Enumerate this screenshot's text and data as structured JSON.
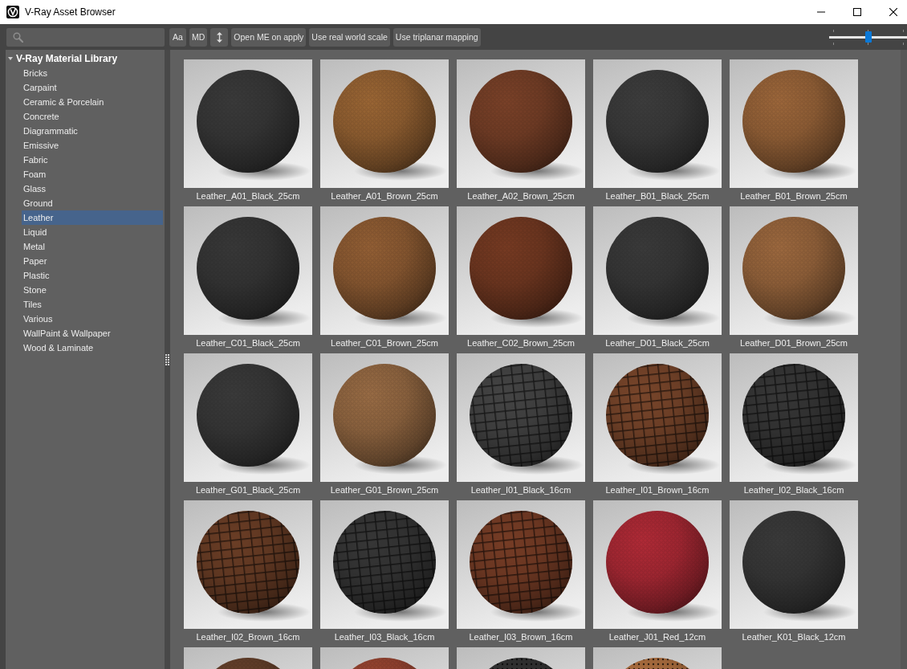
{
  "window": {
    "title": "V-Ray Asset Browser"
  },
  "toolbar": {
    "buttons": [
      {
        "kind": "text",
        "label": "Aa"
      },
      {
        "kind": "text",
        "label": "MD"
      },
      {
        "kind": "arrows"
      },
      {
        "kind": "text",
        "label": "Open ME on apply"
      },
      {
        "kind": "text",
        "label": "Use real world scale"
      },
      {
        "kind": "text",
        "label": "Use triplanar mapping"
      }
    ],
    "slider": {
      "level": 0.5
    }
  },
  "library": {
    "title": "V-Ray Material Library",
    "expanded": true,
    "children": [
      {
        "label": "Bricks",
        "selected": false
      },
      {
        "label": "Carpaint",
        "selected": false
      },
      {
        "label": "Ceramic & Porcelain",
        "selected": false
      },
      {
        "label": "Concrete",
        "selected": false
      },
      {
        "label": "Diagrammatic",
        "selected": false
      },
      {
        "label": "Emissive",
        "selected": false
      },
      {
        "label": "Fabric",
        "selected": false
      },
      {
        "label": "Foam",
        "selected": false
      },
      {
        "label": "Glass",
        "selected": false
      },
      {
        "label": "Ground",
        "selected": false
      },
      {
        "label": "Leather",
        "selected": true
      },
      {
        "label": "Liquid",
        "selected": false
      },
      {
        "label": "Metal",
        "selected": false
      },
      {
        "label": "Paper",
        "selected": false
      },
      {
        "label": "Plastic",
        "selected": false
      },
      {
        "label": "Stone",
        "selected": false
      },
      {
        "label": "Tiles",
        "selected": false
      },
      {
        "label": "Various",
        "selected": false
      },
      {
        "label": "WallPaint & Wallpaper",
        "selected": false
      },
      {
        "label": "Wood & Laminate",
        "selected": false
      }
    ]
  },
  "materials": [
    {
      "label": "Leather_A01_Black_25cm",
      "color": "#3a3a3a",
      "kind": "pebbled"
    },
    {
      "label": "Leather_A01_Brown_25cm",
      "color": "#9a6534",
      "kind": "pebbled"
    },
    {
      "label": "Leather_A02_Brown_25cm",
      "color": "#7a4128",
      "kind": "pebbled"
    },
    {
      "label": "Leather_B01_Black_25cm",
      "color": "#3d3d3d",
      "kind": "pebbled"
    },
    {
      "label": "Leather_B01_Brown_25cm",
      "color": "#9c663a",
      "kind": "pebbled"
    },
    {
      "label": "Leather_C01_Black_25cm",
      "color": "#383838",
      "kind": "pebbled"
    },
    {
      "label": "Leather_C01_Brown_25cm",
      "color": "#925e34",
      "kind": "pebbled"
    },
    {
      "label": "Leather_C02_Brown_25cm",
      "color": "#763a22",
      "kind": "pebbled"
    },
    {
      "label": "Leather_D01_Black_25cm",
      "color": "#3a3a3a",
      "kind": "pebbled"
    },
    {
      "label": "Leather_D01_Brown_25cm",
      "color": "#9c683e",
      "kind": "pebbled"
    },
    {
      "label": "Leather_G01_Black_25cm",
      "color": "#3a3a3a",
      "kind": "pebbled"
    },
    {
      "label": "Leather_G01_Brown_25cm",
      "color": "#986b44",
      "kind": "pebbled"
    },
    {
      "label": "Leather_I01_Black_16cm",
      "color": "#444444",
      "kind": "scaled"
    },
    {
      "label": "Leather_I01_Brown_16cm",
      "color": "#78452a",
      "kind": "scaled"
    },
    {
      "label": "Leather_I02_Black_16cm",
      "color": "#363636",
      "kind": "scaled"
    },
    {
      "label": "Leather_I02_Brown_16cm",
      "color": "#6a3d25",
      "kind": "scaled"
    },
    {
      "label": "Leather_I03_Black_16cm",
      "color": "#363636",
      "kind": "scaled"
    },
    {
      "label": "Leather_I03_Brown_16cm",
      "color": "#763c25",
      "kind": "scaled"
    },
    {
      "label": "Leather_J01_Red_12cm",
      "color": "#b02a36",
      "kind": "pebbled"
    },
    {
      "label": "Leather_K01_Black_12cm",
      "color": "#3a3a3a",
      "kind": "pebbled"
    },
    {
      "color": "#68422c",
      "kind": "pebbled"
    },
    {
      "color": "#9c4632",
      "kind": "pebbled"
    },
    {
      "color": "#333333",
      "kind": "perforated"
    },
    {
      "color": "#b07040",
      "kind": "perforated"
    }
  ]
}
